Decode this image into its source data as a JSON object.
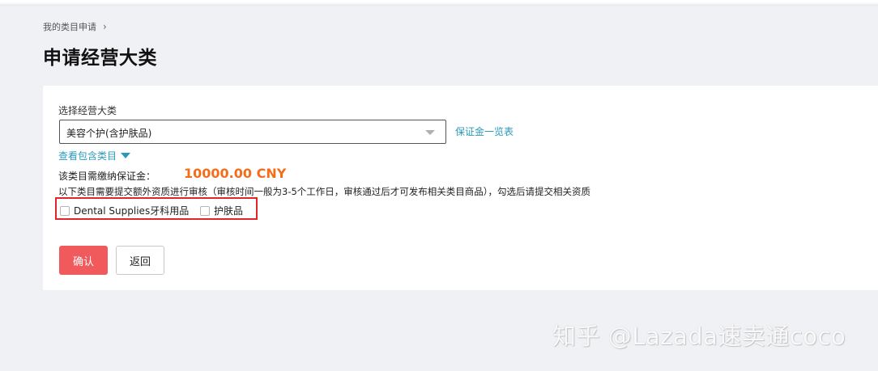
{
  "breadcrumb": {
    "item": "我的类目申请",
    "separator": "›"
  },
  "page_title": "申请经营大类",
  "form": {
    "category_label": "选择经营大类",
    "category_value": "美容个护(含护肤品)",
    "deposit_list_link": "保证金一览表",
    "view_subcategories": "查看包含类目",
    "deposit_label": "该类目需缴纳保证金：",
    "deposit_amount": "10000.00 CNY",
    "notice": "以下类目需要提交额外资质进行审核（审核时间一般为3-5个工作日，审核通过后才可发布相关类目商品），勾选后请提交相关资质",
    "subcategories": [
      {
        "label": "Dental Supplies牙科用品",
        "checked": false
      },
      {
        "label": "护肤品",
        "checked": false
      }
    ]
  },
  "buttons": {
    "confirm": "确认",
    "back": "返回"
  },
  "watermark": "知乎 @Lazada速卖通coco",
  "colors": {
    "accent_link": "#2a9ab8",
    "deposit_amount": "#f36d1b",
    "confirm_button": "#f05a5c",
    "highlight_border": "#e0262c",
    "page_background": "#f0f1f4"
  }
}
